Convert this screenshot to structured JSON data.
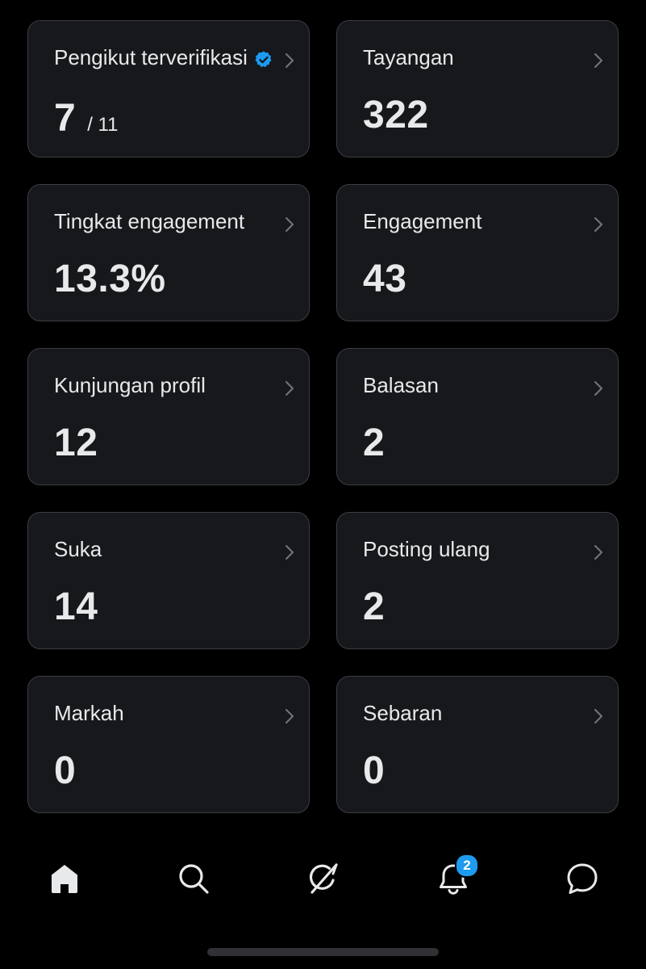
{
  "stats": [
    {
      "label": "Pengikut terverifikasi",
      "value": "7",
      "total": "/ 11"
    },
    {
      "label": "Tayangan",
      "value": "322"
    },
    {
      "label": "Tingkat engagement",
      "value": "13.3%"
    },
    {
      "label": "Engagement",
      "value": "43"
    },
    {
      "label": "Kunjungan profil",
      "value": "12"
    },
    {
      "label": "Balasan",
      "value": "2"
    },
    {
      "label": "Suka",
      "value": "14"
    },
    {
      "label": "Posting ulang",
      "value": "2"
    },
    {
      "label": "Markah",
      "value": "0"
    },
    {
      "label": "Sebaran",
      "value": "0"
    }
  ],
  "bottom_nav": {
    "items": [
      {
        "icon": "home-icon",
        "active": true
      },
      {
        "icon": "search-icon",
        "active": false
      },
      {
        "icon": "grok-icon",
        "active": false
      },
      {
        "icon": "bell-icon",
        "active": false,
        "badge": "2"
      },
      {
        "icon": "message-icon",
        "active": false
      }
    ]
  },
  "colors": {
    "background": "#000000",
    "card_background": "#16181c",
    "card_border": "#3a3d42",
    "text_primary": "#e7e9ea",
    "text_secondary": "#71767b",
    "accent": "#1d9bf0"
  }
}
